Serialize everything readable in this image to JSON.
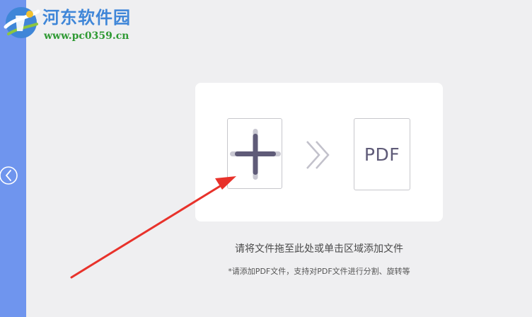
{
  "watermark": {
    "title": "河东软件园",
    "url": "www.pc0359.cn",
    "icon": "logo-icon"
  },
  "sidebar": {
    "back_icon": "chevron-left-icon",
    "color": "#6f95ee"
  },
  "drop_zone": {
    "add_icon": "plus-icon",
    "arrow_icon": "double-chevron-right-icon",
    "target_label": "PDF",
    "instruction": "请将文件拖至此处或单击区域添加文件",
    "hint": "*请添加PDF文件，支持对PDF文件进行分割、旋转等"
  },
  "colors": {
    "background": "#efeff1",
    "card": "#ffffff",
    "accent": "#6f95ee",
    "annotation": "#e8322b",
    "icon": "#5f5b78"
  }
}
